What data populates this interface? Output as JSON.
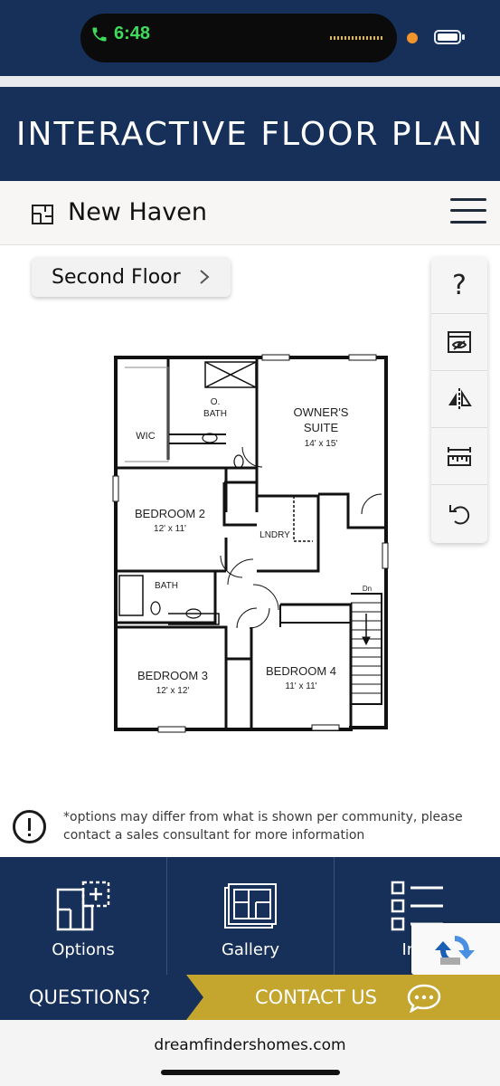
{
  "status_bar": {
    "time": "6:48",
    "accent_call": "#3ddc5a",
    "icons": [
      "phone-icon",
      "waveform-icon",
      "recording-dot-icon",
      "battery-icon"
    ]
  },
  "header": {
    "title": "INTERACTIVE FLOOR PLAN",
    "background": "#17305a"
  },
  "home_bar": {
    "name": "New Haven",
    "icons": [
      "floorplan-icon",
      "hamburger-menu-icon"
    ]
  },
  "floor_selector": {
    "label": "Second Floor"
  },
  "tools": {
    "help_label": "?",
    "icons": [
      "help-icon",
      "furniture-view-icon",
      "mirror-icon",
      "measure-icon",
      "reset-icon"
    ]
  },
  "floorplan": {
    "rooms": {
      "owners_suite": "OWNER'S",
      "owners_suite_2": "SUITE",
      "owners_suite_dim": "14' x 15'",
      "o_bath_1": "O.",
      "o_bath_2": "BATH",
      "wic": "WIC",
      "bedroom2": "BEDROOM 2",
      "bedroom2_dim": "12' x 11'",
      "lndry": "LNDRY",
      "bath": "BATH",
      "bedroom3": "BEDROOM 3",
      "bedroom3_dim": "12' x 12'",
      "bedroom4": "BEDROOM 4",
      "bedroom4_dim": "11' x 11'",
      "stairs": "Dn"
    }
  },
  "disclaimer": {
    "text": "*options may differ from what is shown per community, please contact a sales consultant for more information"
  },
  "tiles": [
    {
      "label": "Options",
      "icon": "options-plan-icon"
    },
    {
      "label": "Gallery",
      "icon": "gallery-icon"
    },
    {
      "label": "Info",
      "icon": "list-icon"
    }
  ],
  "cta": {
    "questions": "QUESTIONS?",
    "contact": "CONTACT US",
    "gold": "#c4a52e"
  },
  "browser": {
    "url": "dreamfindershomes.com"
  }
}
